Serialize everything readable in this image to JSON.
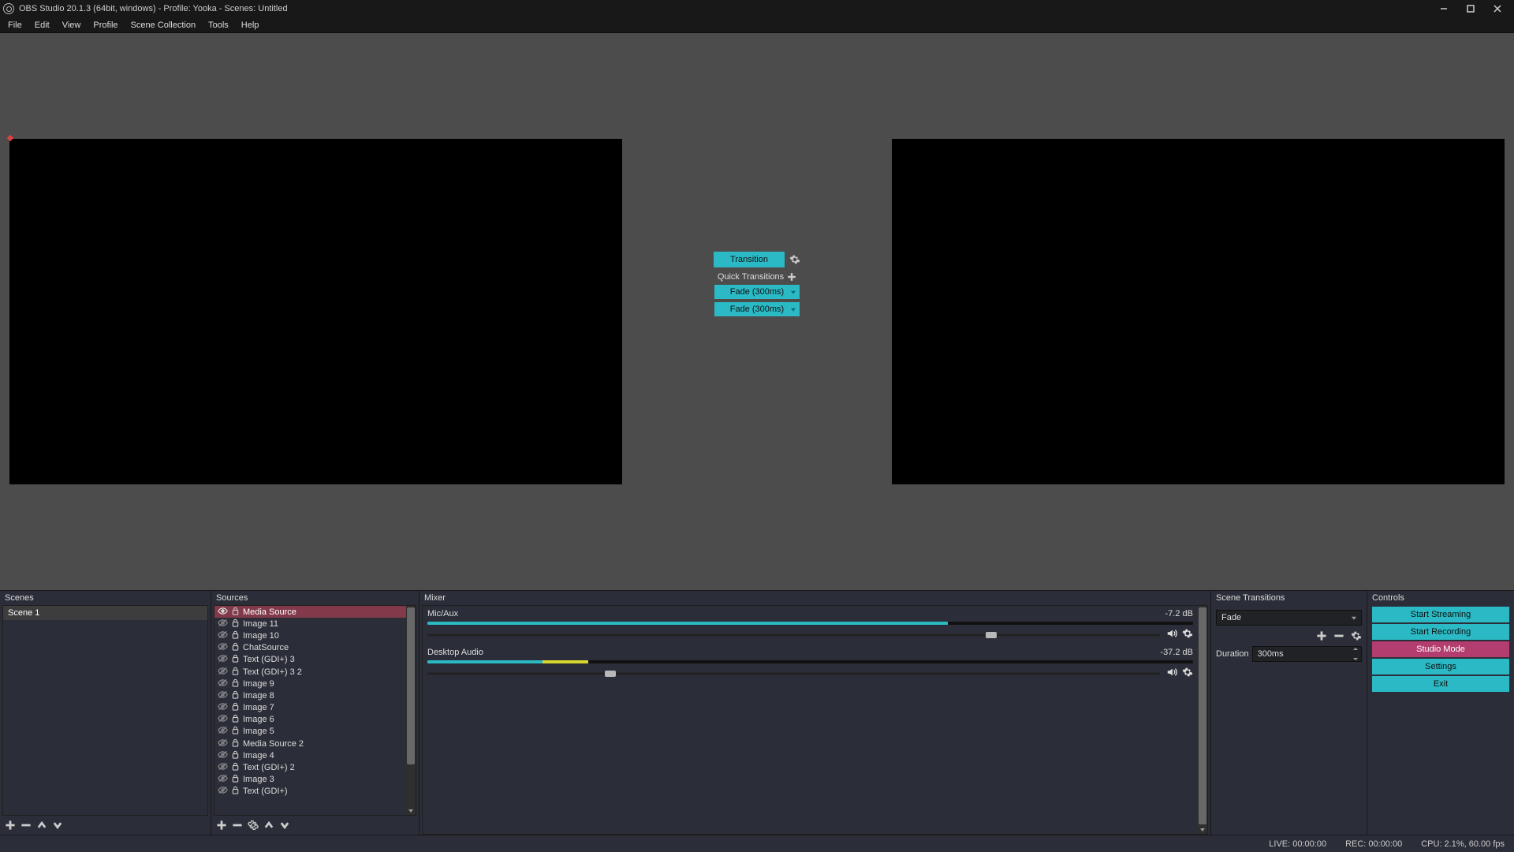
{
  "window": {
    "title": "OBS Studio 20.1.3 (64bit, windows) - Profile: Yooka - Scenes: Untitled"
  },
  "menu": {
    "items": [
      "File",
      "Edit",
      "View",
      "Profile",
      "Scene Collection",
      "Tools",
      "Help"
    ]
  },
  "center": {
    "transition_btn": "Transition",
    "quick_transitions_label": "Quick Transitions",
    "fade1": "Fade (300ms)",
    "fade2": "Fade (300ms)"
  },
  "docks": {
    "scenes": {
      "title": "Scenes"
    },
    "sources": {
      "title": "Sources"
    },
    "mixer": {
      "title": "Mixer"
    },
    "transitions": {
      "title": "Scene Transitions"
    },
    "controls": {
      "title": "Controls"
    }
  },
  "scenes": {
    "items": [
      {
        "name": "Scene 1"
      }
    ]
  },
  "sources": {
    "items": [
      {
        "name": "Media Source",
        "visible": true,
        "selected": true
      },
      {
        "name": "Image 11",
        "visible": false,
        "selected": false
      },
      {
        "name": "Image 10",
        "visible": false,
        "selected": false
      },
      {
        "name": "ChatSource",
        "visible": false,
        "selected": false
      },
      {
        "name": "Text (GDI+) 3",
        "visible": false,
        "selected": false
      },
      {
        "name": "Text (GDI+) 3 2",
        "visible": false,
        "selected": false
      },
      {
        "name": "Image 9",
        "visible": false,
        "selected": false
      },
      {
        "name": "Image 8",
        "visible": false,
        "selected": false
      },
      {
        "name": "Image 7",
        "visible": false,
        "selected": false
      },
      {
        "name": "Image 6",
        "visible": false,
        "selected": false
      },
      {
        "name": "Image 5",
        "visible": false,
        "selected": false
      },
      {
        "name": "Media Source 2",
        "visible": false,
        "selected": false
      },
      {
        "name": "Image 4",
        "visible": false,
        "selected": false
      },
      {
        "name": "Text (GDI+) 2",
        "visible": false,
        "selected": false
      },
      {
        "name": "Image 3",
        "visible": false,
        "selected": false
      },
      {
        "name": "Text (GDI+)",
        "visible": false,
        "selected": false
      }
    ]
  },
  "mixer": {
    "channels": [
      {
        "name": "Mic/Aux",
        "db": "-7.2 dB",
        "meter_cyan_pct": 68,
        "meter_yellow_start": 68,
        "meter_yellow_end": 68,
        "knob_pct": 77
      },
      {
        "name": "Desktop Audio",
        "db": "-37.2 dB",
        "meter_cyan_pct": 15,
        "meter_yellow_start": 15,
        "meter_yellow_end": 21,
        "knob_pct": 25
      }
    ]
  },
  "transitions": {
    "current": "Fade",
    "duration_label": "Duration",
    "duration_value": "300ms"
  },
  "controls": {
    "buttons": [
      {
        "label": "Start Streaming",
        "style": "cyan"
      },
      {
        "label": "Start Recording",
        "style": "cyan"
      },
      {
        "label": "Studio Mode",
        "style": "magenta"
      },
      {
        "label": "Settings",
        "style": "cyan"
      },
      {
        "label": "Exit",
        "style": "cyan"
      }
    ]
  },
  "status": {
    "live": "LIVE: 00:00:00",
    "rec": "REC: 00:00:00",
    "cpu": "CPU: 2.1%, 60.00 fps"
  }
}
